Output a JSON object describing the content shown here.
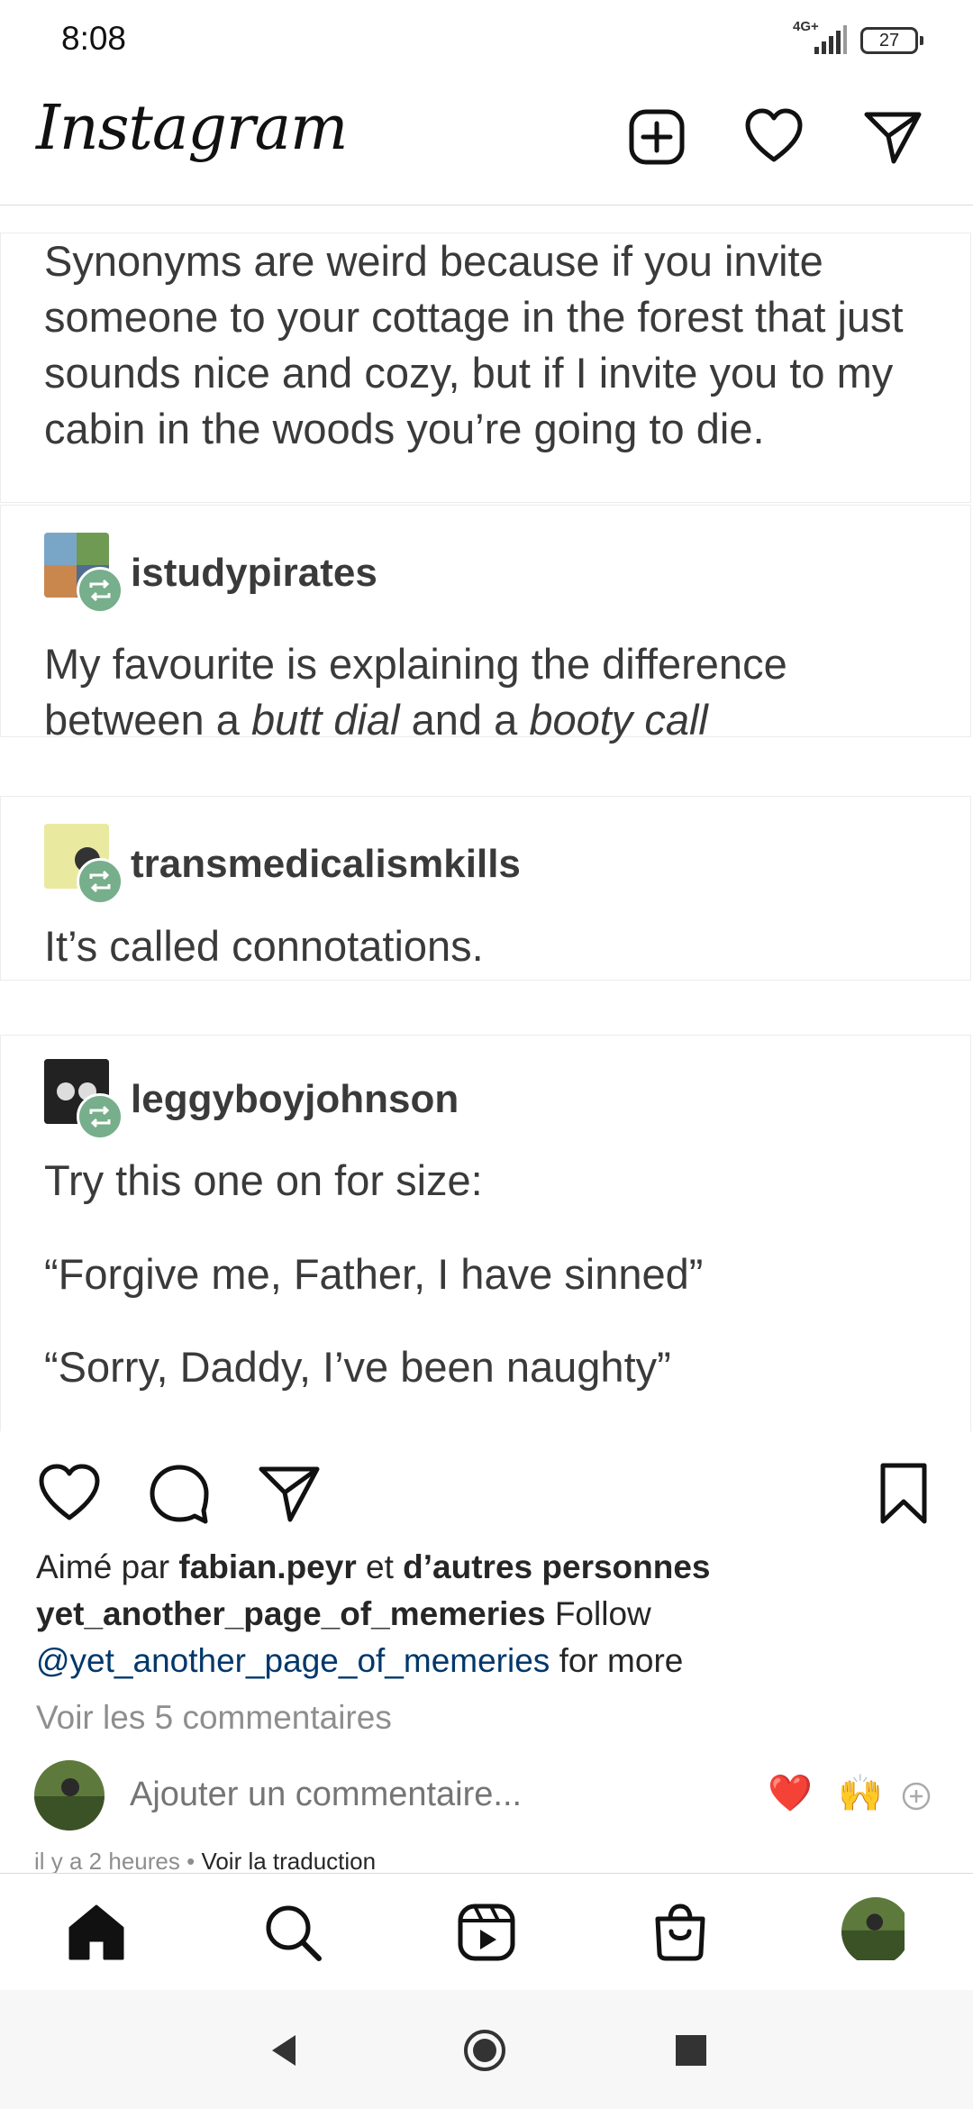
{
  "status_bar": {
    "time": "8:08",
    "network": "4G+",
    "battery": "27"
  },
  "header": {
    "logo": "Instagram",
    "icons": [
      "new-post-icon",
      "heart-icon",
      "direct-message-icon"
    ]
  },
  "post": {
    "tumblr": {
      "intro_text": "Synonyms are weird because if you invite someone to your cottage in the forest that just sounds nice and cozy, but if I invite you to my cabin in the woods you’re going to die.",
      "replies": [
        {
          "username": "istudypirates",
          "text_a": "My favourite is explaining the difference",
          "text_b_prefix": "between a ",
          "text_b_em1": "butt dial",
          "text_b_mid": " and a ",
          "text_b_em2": "booty call"
        },
        {
          "username": "transmedicalismkills",
          "text": "It’s called connotations."
        },
        {
          "username": "leggyboyjohnson",
          "line1": "Try this one on for size:",
          "line2": "“Forgive me, Father, I have sinned”",
          "line3": "“Sorry, Daddy, I’ve been naughty”"
        }
      ]
    },
    "likes": {
      "prefix": "Aimé par ",
      "user": "fabian.peyr",
      "mid": " et ",
      "others": "d’autres personnes"
    },
    "caption": {
      "username": "yet_another_page_of_memeries",
      "text": " Follow",
      "mention": "@yet_another_page_of_memeries",
      "suffix": " for more"
    },
    "view_comments": "Voir les 5 commentaires",
    "comment_placeholder": "Ajouter un commentaire...",
    "quick_emojis": [
      "❤️",
      "🙌"
    ],
    "timestamp": "il y a 2 heures",
    "separator": " • ",
    "translate": "Voir la traduction"
  },
  "bottom_nav": [
    "home-icon",
    "search-icon",
    "reels-icon",
    "shop-icon",
    "profile-avatar"
  ],
  "colors": {
    "reblog_badge": "#77ae8b",
    "mention": "#00376b",
    "secondary_text": "#8e8e8e"
  }
}
